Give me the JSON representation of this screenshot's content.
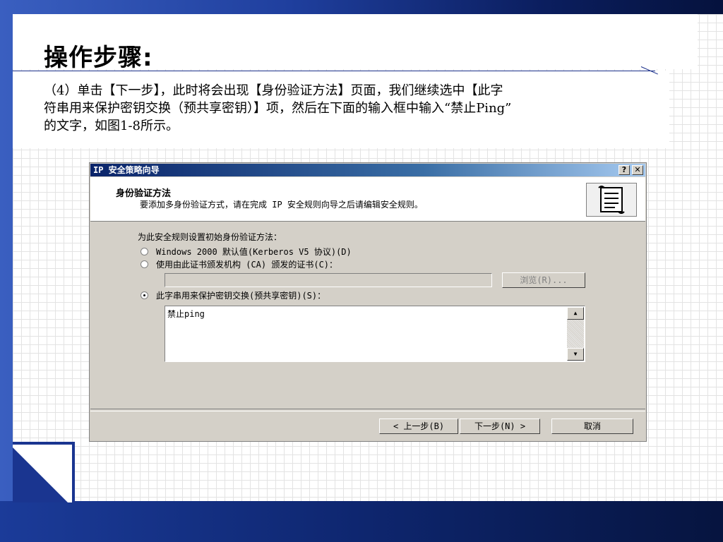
{
  "slide": {
    "title": "操作步骤:",
    "paragraph_lines": [
      "（4）单击【下一步】，此时将会出现【身份验证方法】页面，我们继续选中【此字",
      "符串用来保护密钥交换（预共享密钥）】项，然后在下面的输入框中输入“禁止Ping”",
      "的文字，如图1-8所示。"
    ]
  },
  "dialog": {
    "title": "IP 安全策略向导",
    "help_button": "?",
    "close_button": "✕",
    "header_title": "身份验证方法",
    "header_subtitle": "要添加多身份验证方式，请在完成 IP 安全规则向导之后请编辑安全规则。",
    "section_label": "为此安全规则设置初始身份验证方法：",
    "options": [
      {
        "label": "Windows 2000 默认值(Kerberos V5 协议)(D)",
        "selected": false
      },
      {
        "label": "使用由此证书颁发机构 (CA) 颁发的证书(C)：",
        "selected": false
      },
      {
        "label": "此字串用来保护密钥交换(预共享密钥)(S)：",
        "selected": true
      }
    ],
    "ca_field_value": "",
    "browse_button": "浏览(R)...",
    "preshared_key_value": "禁止ping",
    "back_button": "< 上一步(B)",
    "next_button": "下一步(N) >",
    "cancel_button": "取消",
    "icons": {
      "header": "scroll-document-icon",
      "scroll_up": "scroll-up-arrow-icon",
      "scroll_down": "scroll-down-arrow-icon"
    }
  }
}
